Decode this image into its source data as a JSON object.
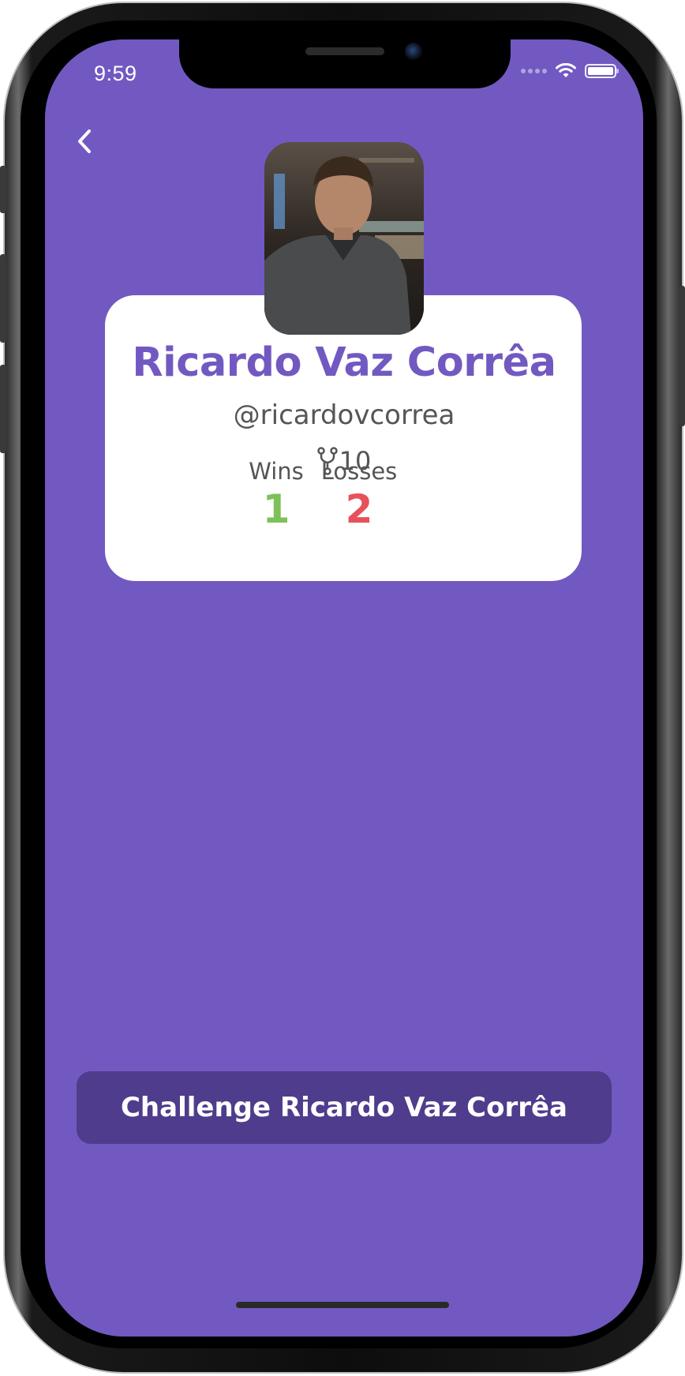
{
  "status_bar": {
    "time": "9:59",
    "icons": [
      "signal-dots-icon",
      "wifi-icon",
      "battery-icon"
    ]
  },
  "nav": {
    "back_icon": "chevron-left-icon"
  },
  "profile": {
    "name": "Ricardo Vaz Corrêa",
    "handle": "@ricardovcorrea",
    "forks_icon": "fork-icon",
    "forks_count": "10",
    "wins_label": "Wins",
    "wins_value": "1",
    "losses_label": "Losses",
    "losses_value": "2"
  },
  "actions": {
    "challenge_label": "Challenge Ricardo Vaz Corrêa"
  },
  "colors": {
    "background": "#7259C1",
    "accent": "#7259C1",
    "button": "#4F3C8C",
    "wins": "#7DC158",
    "losses": "#E5525A"
  }
}
